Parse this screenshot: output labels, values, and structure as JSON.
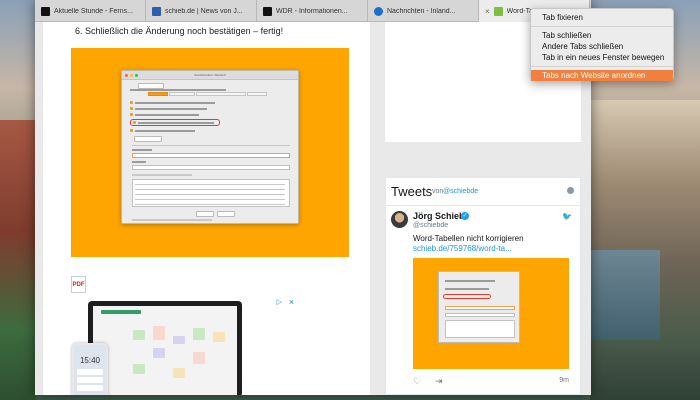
{
  "tabs": [
    {
      "title": "Aktuelle Stunde - Ferns...",
      "favicon": "wdr-logo-icon",
      "active": false
    },
    {
      "title": "schieb.de | News von J...",
      "favicon": "schieb-logo-icon",
      "active": false
    },
    {
      "title": "WDR - Informationen...",
      "favicon": "wdr-logo-icon",
      "active": false
    },
    {
      "title": "Nachrichten - Inland...",
      "favicon": "tagesschau-icon",
      "active": false
    },
    {
      "title": "Word-Tabellen",
      "favicon": "word-icon",
      "active": true
    }
  ],
  "article": {
    "step_text": "6.  Schließlich die Änderung noch bestätigen – fertig!",
    "dialog_title": "AutoKorrektur: Deutsch",
    "pdf_label": "PDF",
    "ad": {
      "close": "×",
      "phone_time": "15:40"
    }
  },
  "tweets": {
    "title": "Tweets",
    "von": "von",
    "handle": "@schiebde",
    "name": "Jörg Schieb",
    "verified": "✓",
    "user": "@schiebde",
    "text": "Word-Tabellen nicht korrigieren",
    "link": "schieb.de/759768/word-ta...",
    "time": "9m"
  },
  "context_menu": {
    "items": [
      {
        "label": "Tab fixieren"
      },
      {
        "label": "Tab schließen"
      },
      {
        "label": "Andere Tabs schließen"
      },
      {
        "label": "Tab in ein neues Fenster bewegen"
      },
      {
        "label": "Tabs nach Website anordnen",
        "selected": true
      }
    ]
  },
  "colors": {
    "accent_orange": "#ffa502",
    "menu_highlight": "#f17f3e",
    "twitter_blue": "#1b95e0"
  }
}
